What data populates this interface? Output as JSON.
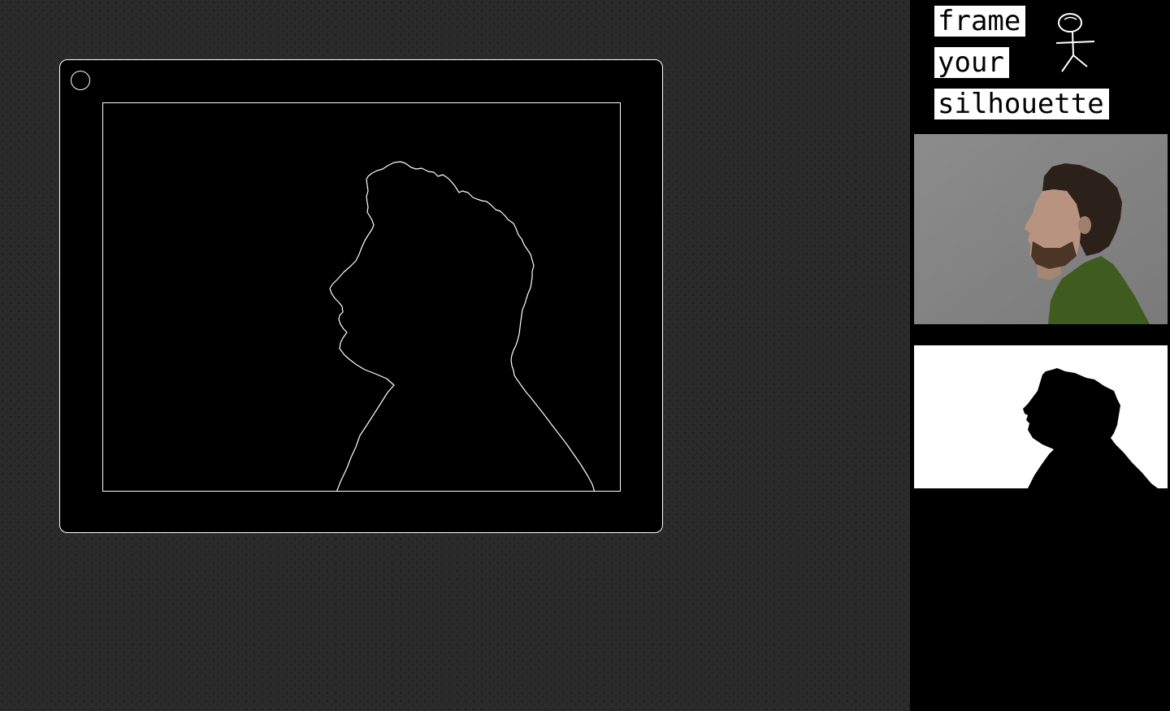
{
  "sidebar": {
    "title_words": [
      "frame",
      "your",
      "silhouette"
    ],
    "logo_icon": "stick-figure-icon"
  },
  "colors": {
    "background": "#2b2b2b",
    "panel": "#000000",
    "outline": "#ffffff",
    "photo_wall": "#8a8a8a",
    "sweater": "#3d5a1c",
    "hair": "#2a1f17",
    "mask_bg": "#ffffff"
  },
  "icons": [
    "record-button-icon",
    "stick-figure-icon"
  ]
}
